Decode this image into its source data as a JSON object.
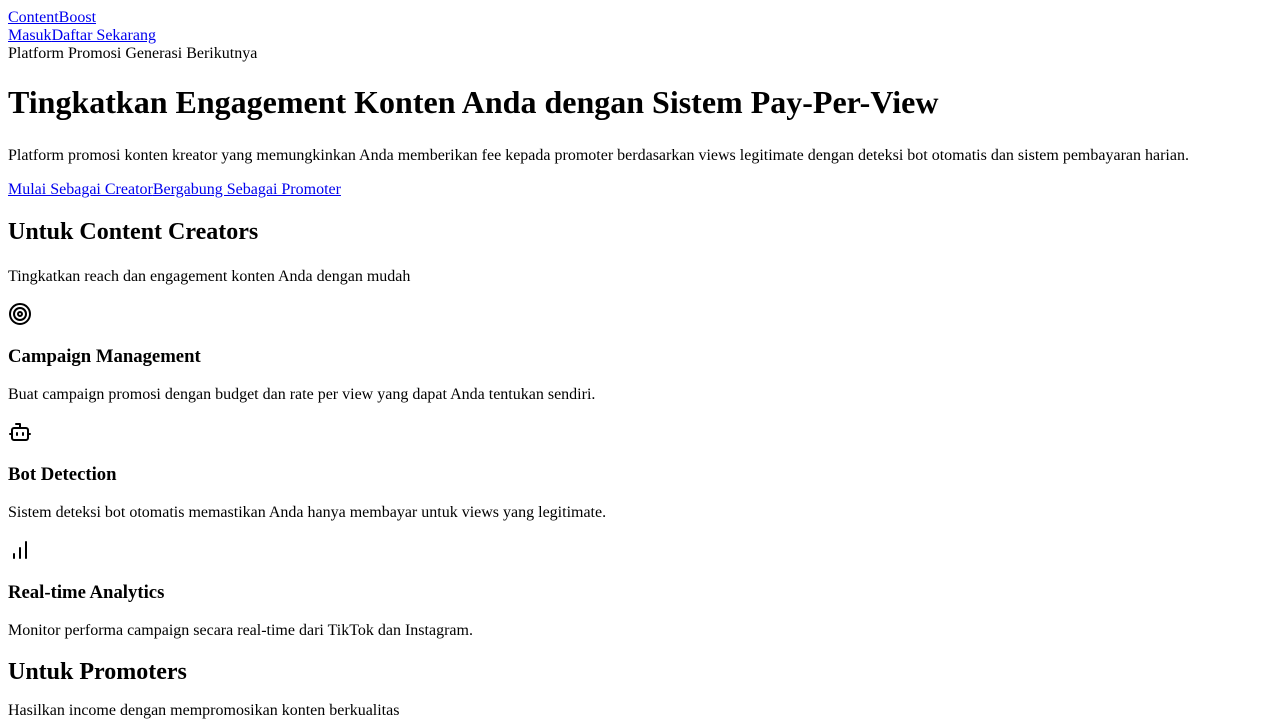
{
  "nav": {
    "brand": "ContentBoost",
    "login": "Masuk",
    "signup": "Daftar Sekarang"
  },
  "hero": {
    "badge": "Platform Promosi Generasi Berikutnya",
    "title": "Tingkatkan Engagement Konten Anda dengan Sistem Pay-Per-View",
    "description": "Platform promosi konten kreator yang memungkinkan Anda memberikan fee kepada promoter berdasarkan views legitimate dengan deteksi bot otomatis dan sistem pembayaran harian.",
    "cta_creator": "Mulai Sebagai Creator",
    "cta_promoter": "Bergabung Sebagai Promoter"
  },
  "creators": {
    "heading": "Untuk Content Creators",
    "subheading": "Tingkatkan reach dan engagement konten Anda dengan mudah",
    "features": [
      {
        "icon": "target-icon",
        "title": "Campaign Management",
        "description": "Buat campaign promosi dengan budget dan rate per view yang dapat Anda tentukan sendiri."
      },
      {
        "icon": "bot-icon",
        "title": "Bot Detection",
        "description": "Sistem deteksi bot otomatis memastikan Anda hanya membayar untuk views yang legitimate."
      },
      {
        "icon": "bar-chart-icon",
        "title": "Real-time Analytics",
        "description": "Monitor performa campaign secara real-time dari TikTok dan Instagram."
      }
    ]
  },
  "promoters": {
    "heading": "Untuk Promoters",
    "subheading": "Hasilkan income dengan mempromosikan konten berkualitas"
  }
}
